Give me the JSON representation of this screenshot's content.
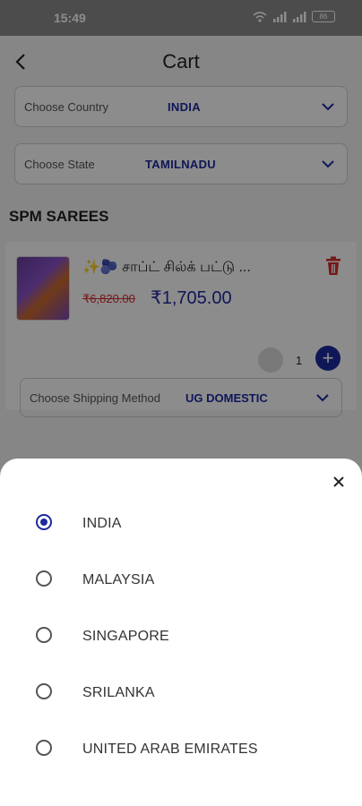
{
  "status_bar": {
    "time": "15:49",
    "battery": "86"
  },
  "header": {
    "title": "Cart"
  },
  "country_select": {
    "label": "Choose Country",
    "value": "INDIA"
  },
  "state_select": {
    "label": "Choose State",
    "value": "TAMILNADU"
  },
  "store": {
    "name": "SPM SAREES"
  },
  "cart_item": {
    "name": "✨🫐 சாப்ட் சில்க் பட்டு ...",
    "old_price": "₹6,820.00",
    "new_price": "₹1,705.00",
    "quantity": "1",
    "plus": "+",
    "shipping": {
      "label": "Choose Shipping Method",
      "value": "UG DOMESTIC"
    }
  },
  "country_options": [
    {
      "label": "INDIA",
      "selected": true
    },
    {
      "label": "MALAYSIA",
      "selected": false
    },
    {
      "label": "SINGAPORE",
      "selected": false
    },
    {
      "label": "SRILANKA",
      "selected": false
    },
    {
      "label": "UNITED ARAB EMIRATES",
      "selected": false
    }
  ],
  "colors": {
    "accent": "#1e2aa0",
    "danger": "#d32f2f"
  },
  "icons": [
    "back-arrow-icon",
    "chevron-down-icon",
    "trash-icon",
    "close-icon",
    "wifi-icon",
    "signal-icon",
    "battery-icon"
  ]
}
